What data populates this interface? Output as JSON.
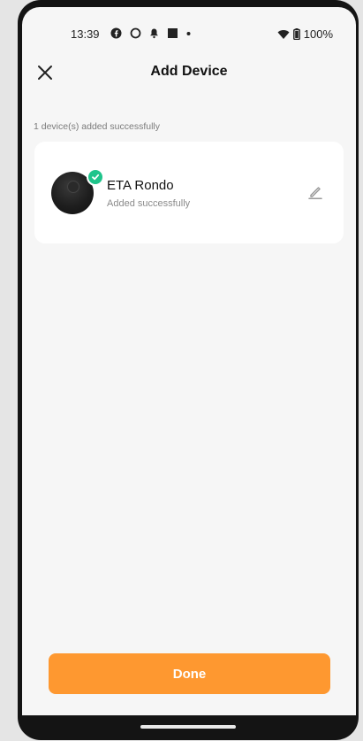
{
  "status_bar": {
    "time": "13:39",
    "battery": "100%",
    "icons": [
      "facebook-icon",
      "circle-icon",
      "notification-bell-icon",
      "square-icon",
      "dot-icon",
      "wifi-icon",
      "battery-icon"
    ]
  },
  "header": {
    "title": "Add Device",
    "close_icon": "close-icon"
  },
  "summary": {
    "added_count_text": "1 device(s) added successfully"
  },
  "devices": [
    {
      "name": "ETA Rondo",
      "status": "Added successfully",
      "badge_icon": "check-icon",
      "edit_icon": "edit-pencil-icon"
    }
  ],
  "footer": {
    "done_label": "Done"
  },
  "colors": {
    "accent": "#fe9830",
    "success": "#1fc48b",
    "background": "#f6f6f6",
    "card": "#ffffff"
  }
}
